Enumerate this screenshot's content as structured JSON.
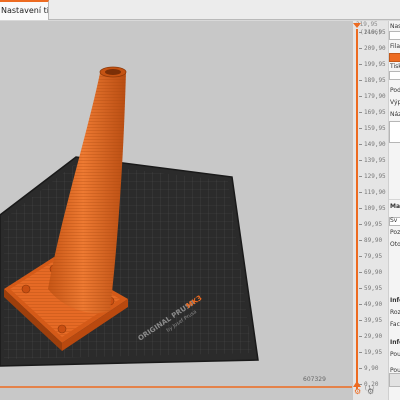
{
  "tabs": [
    {
      "label": "Nastavení tiskárny"
    }
  ],
  "bed": {
    "brand": "ORIGINAL PRUSA",
    "model": "MK3",
    "sub": "by Josef Prusa"
  },
  "vertical_slider": {
    "top_value": "219,95",
    "top_layer": "(1466)",
    "values": [
      "219,95",
      "209,90",
      "199,95",
      "189,95",
      "179,90",
      "169,95",
      "159,95",
      "149,90",
      "139,95",
      "129,95",
      "119,90",
      "109,95",
      "99,95",
      "89,90",
      "79,95",
      "69,90",
      "59,95",
      "49,90",
      "39,95",
      "29,90",
      "19,95",
      "9,90",
      "0,20"
    ],
    "bottom_layer": "(1)"
  },
  "horizontal_slider": {
    "label": "607329"
  },
  "panel": {
    "rows": [
      {
        "text": "Nast",
        "bold": false
      },
      {
        "text": "Filam",
        "bold": false
      },
      {
        "text": "Tiskár",
        "bold": false
      },
      {
        "text": "Podp",
        "bold": false
      },
      {
        "text": "Výpl",
        "bold": false
      },
      {
        "text": "Náz",
        "bold": false
      },
      {
        "text": "Ma",
        "bold": true
      },
      {
        "text": "Sv",
        "bold": false
      },
      {
        "text": "Poz",
        "bold": false
      },
      {
        "text": "Oto",
        "bold": false
      },
      {
        "text": "Info",
        "bold": true
      },
      {
        "text": "Roz",
        "bold": false
      },
      {
        "text": "Face",
        "bold": false
      },
      {
        "text": "Info",
        "bold": true
      },
      {
        "text": "Pou",
        "bold": false
      },
      {
        "text": "Pou",
        "bold": false
      }
    ]
  },
  "colors": {
    "accent": "#ed6b21",
    "bed": "#2b2b2b",
    "model": "#e86a22"
  }
}
